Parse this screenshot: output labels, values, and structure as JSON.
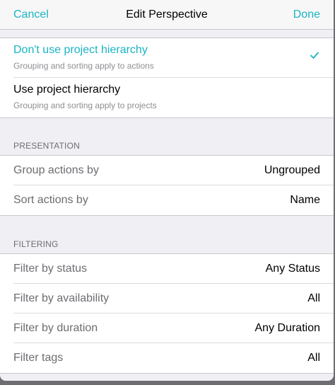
{
  "navbar": {
    "cancel_label": "Cancel",
    "title": "Edit Perspective",
    "done_label": "Done"
  },
  "hierarchy": [
    {
      "title": "Don't use project hierarchy",
      "subtitle": "Grouping and sorting apply to actions",
      "selected": true
    },
    {
      "title": "Use project hierarchy",
      "subtitle": "Grouping and sorting apply to projects",
      "selected": false
    }
  ],
  "presentation": {
    "header": "PRESENTATION",
    "rows": [
      {
        "label": "Group actions by",
        "value": "Ungrouped"
      },
      {
        "label": "Sort actions by",
        "value": "Name"
      }
    ]
  },
  "filtering": {
    "header": "FILTERING",
    "rows": [
      {
        "label": "Filter by status",
        "value": "Any Status"
      },
      {
        "label": "Filter by availability",
        "value": "All"
      },
      {
        "label": "Filter by duration",
        "value": "Any Duration"
      },
      {
        "label": "Filter tags",
        "value": "All"
      }
    ]
  },
  "colors": {
    "accent": "#1bb4c4",
    "background": "#efeff4",
    "backdrop": "#6d6d72"
  },
  "icons": {
    "selected_check": "checkmark-icon"
  }
}
